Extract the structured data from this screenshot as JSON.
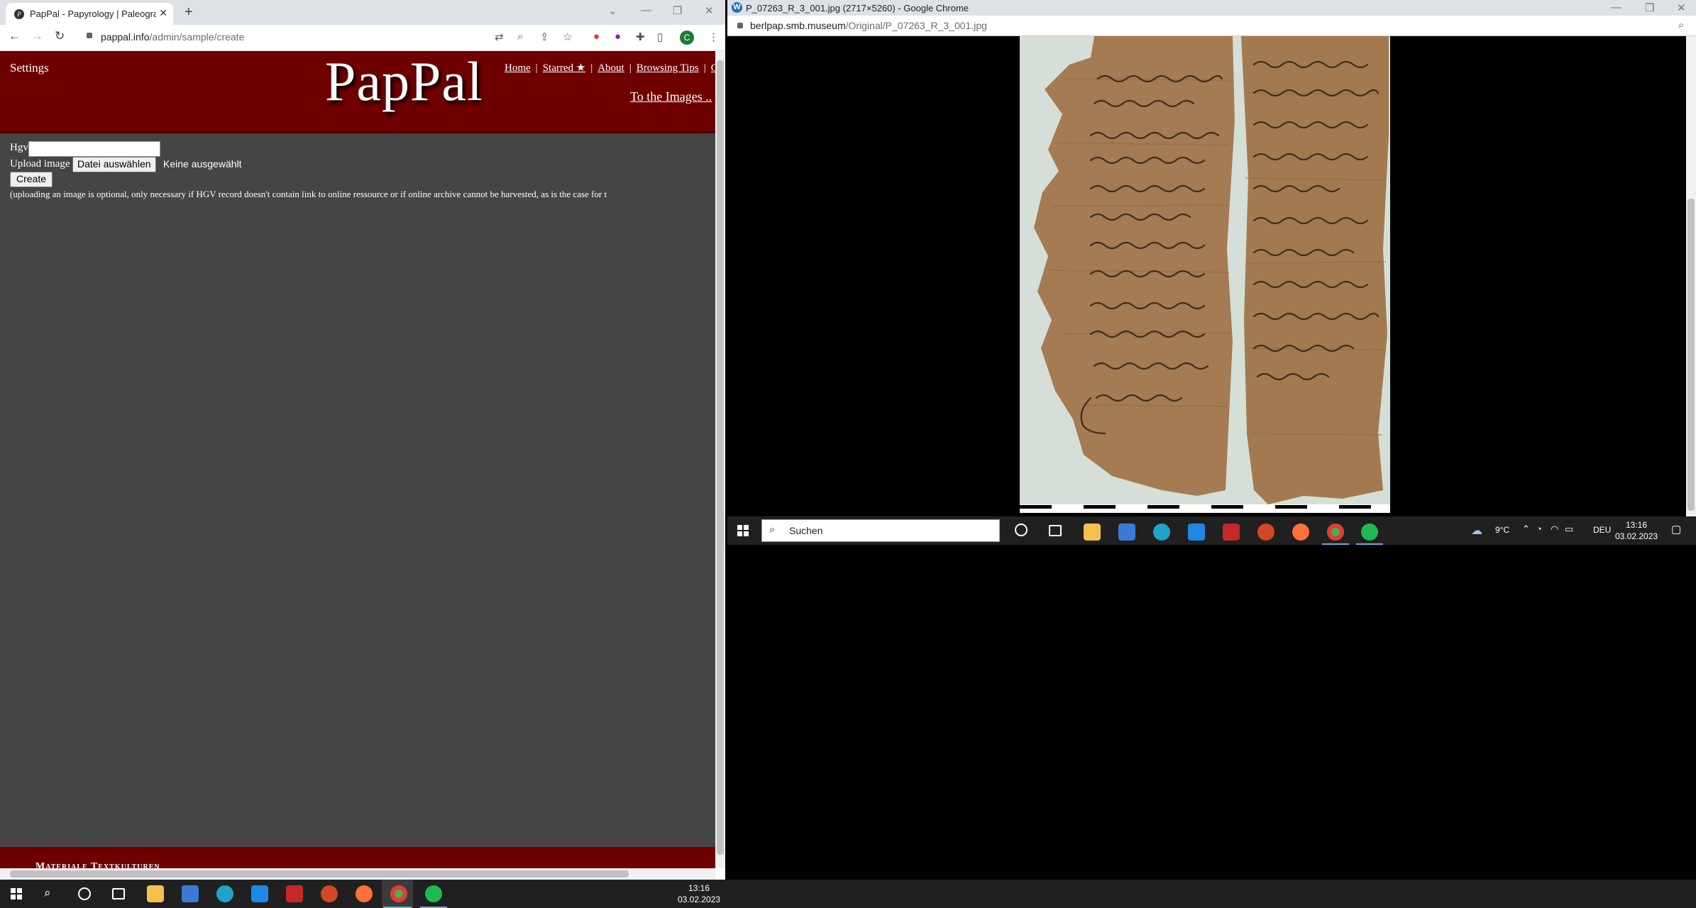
{
  "left_window": {
    "tab_title": "PapPal - Papyrology | Paleograph",
    "url_host": "pappal.info",
    "url_path": "/admin/sample/create",
    "profile_initial": "C"
  },
  "pappal": {
    "settings": "Settings",
    "logo": "PapPal",
    "nav": [
      "Home",
      "Starred ★",
      "About",
      "Browsing Tips",
      "C"
    ],
    "to_images": "To the Images ..",
    "hgv_label": "Hgv",
    "hgv_value": "",
    "upload_label": "Upload image",
    "file_button": "Datei auswählen",
    "file_status": "Keine ausgewählt",
    "create_button": "Create",
    "note": "(uploading an image is optional, only necessary if HGV record doesn't contain link to online ressource or if online archive cannot be harvested, as is the case for t",
    "footer": "Materiale Textkulturen"
  },
  "right_window": {
    "title": "P_07263_R_3_001.jpg (2717×5260) - Google Chrome",
    "url_host": "berlpap.smb.museum",
    "url_path": "/Original/P_07263_R_3_001.jpg"
  },
  "right_taskbar": {
    "search_text": "Suchen",
    "weather": "9°C",
    "language": "DEU",
    "time": "13:16",
    "date": "03.02.2023"
  },
  "taskbar": {
    "time": "13:16",
    "date": "03.02.2023"
  },
  "colors": {
    "header_maroon": "#6f0000",
    "page_bg": "#454545"
  }
}
